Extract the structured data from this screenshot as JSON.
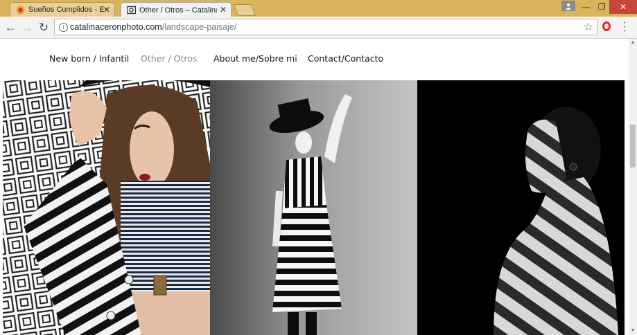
{
  "browser": {
    "tabs": [
      {
        "title": "Sueños Cumplidos - Expl",
        "active": false
      },
      {
        "title": "Other / Otros – Catalina C",
        "active": true
      }
    ],
    "address": {
      "domain": "catalinaceronphoto.com",
      "path": "/landscape-paisaje/"
    },
    "icons": [
      "back-arrow-icon",
      "forward-arrow-icon",
      "reload-icon",
      "info-icon",
      "star-icon",
      "opera-icon",
      "menu-dots-icon",
      "profile-icon"
    ]
  },
  "site": {
    "nav": [
      {
        "label": "New born / Infantil",
        "current": false
      },
      {
        "label": "Other / Otros",
        "current": true
      },
      {
        "label": "About me/Sobre mi",
        "current": false
      },
      {
        "label": "Contact/Contacto",
        "current": false
      }
    ]
  },
  "colors": {
    "titlebar": "#d9b45e",
    "close": "#c7453c",
    "nav_current": "#8a8a8a"
  }
}
